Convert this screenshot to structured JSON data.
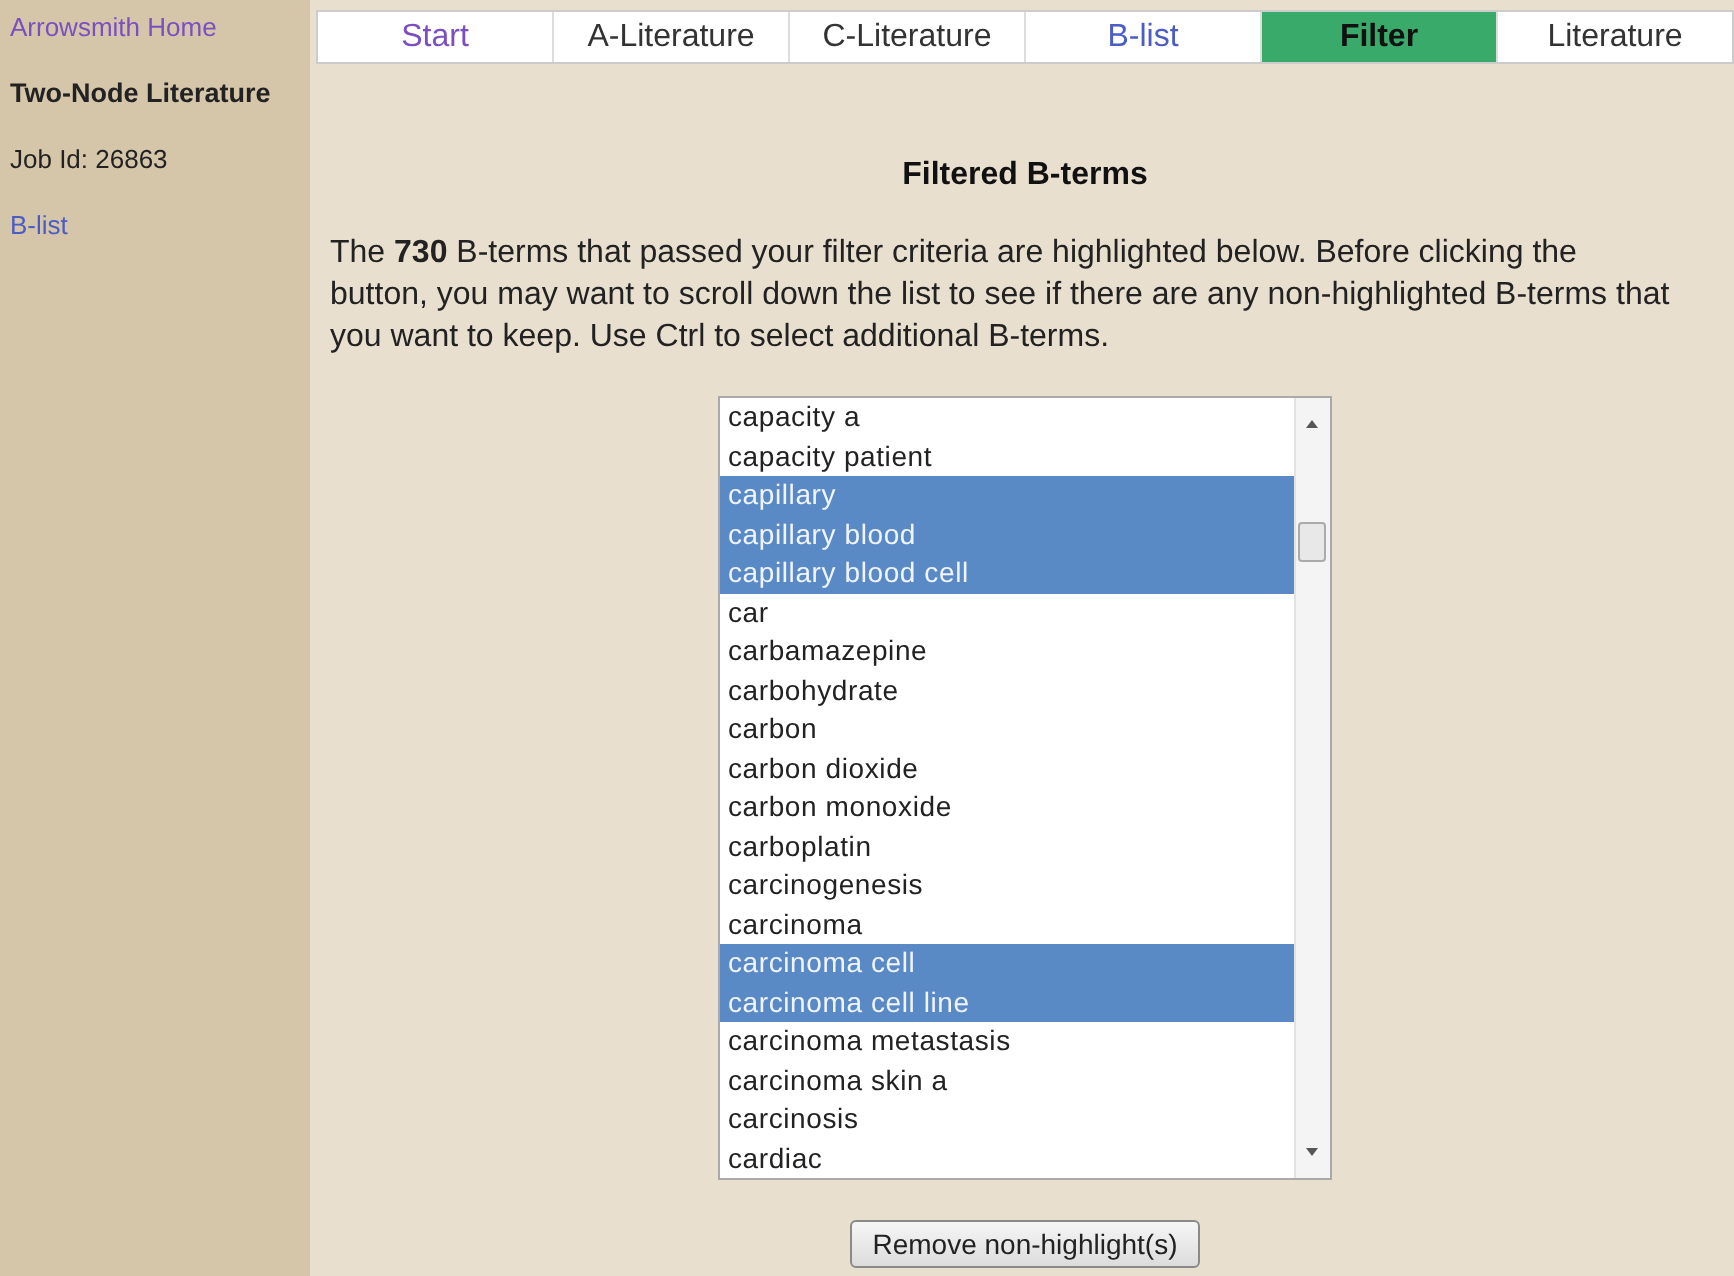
{
  "sidebar": {
    "items": [
      {
        "kind": "visited-link",
        "text": "Arrowsmith Home"
      },
      {
        "kind": "heading",
        "text": "Two-Node Literature"
      },
      {
        "kind": "text",
        "text": "Job Id: 26863"
      },
      {
        "kind": "link",
        "text": "B-list"
      }
    ]
  },
  "tabs": [
    {
      "label": "Start",
      "kind": "visited-link",
      "selected": false
    },
    {
      "label": "A-Literature",
      "kind": "text",
      "selected": false
    },
    {
      "label": "C-Literature",
      "kind": "text",
      "selected": false
    },
    {
      "label": "B-list",
      "kind": "link",
      "selected": false
    },
    {
      "label": "Filter",
      "kind": "text",
      "selected": true
    },
    {
      "label": "Literature",
      "kind": "text",
      "selected": false
    }
  ],
  "heading": "Filtered B-terms",
  "intro": "The **730** B-terms that passed your filter criteria are highlighted below. Before clicking the button, you may want to scroll down the list to see if there are any non-highlighted B-terms that you want to keep. Use Ctrl to select additional B-terms.",
  "terms": [
    {
      "text": "capacity a",
      "selected": false
    },
    {
      "text": "capacity patient",
      "selected": false
    },
    {
      "text": "capillary",
      "selected": true
    },
    {
      "text": "capillary blood",
      "selected": true
    },
    {
      "text": "capillary blood cell",
      "selected": true
    },
    {
      "text": "car",
      "selected": false
    },
    {
      "text": "carbamazepine",
      "selected": false
    },
    {
      "text": "carbohydrate",
      "selected": false
    },
    {
      "text": "carbon",
      "selected": false
    },
    {
      "text": "carbon dioxide",
      "selected": false
    },
    {
      "text": "carbon monoxide",
      "selected": false
    },
    {
      "text": "carboplatin",
      "selected": false
    },
    {
      "text": "carcinogenesis",
      "selected": false
    },
    {
      "text": "carcinoma",
      "selected": false
    },
    {
      "text": "carcinoma cell",
      "selected": true
    },
    {
      "text": "carcinoma cell line",
      "selected": true
    },
    {
      "text": "carcinoma metastasis",
      "selected": false
    },
    {
      "text": "carcinoma skin a",
      "selected": false
    },
    {
      "text": "carcinosis",
      "selected": false
    },
    {
      "text": "cardiac",
      "selected": false
    }
  ],
  "button": "Remove non-highlight(s)"
}
